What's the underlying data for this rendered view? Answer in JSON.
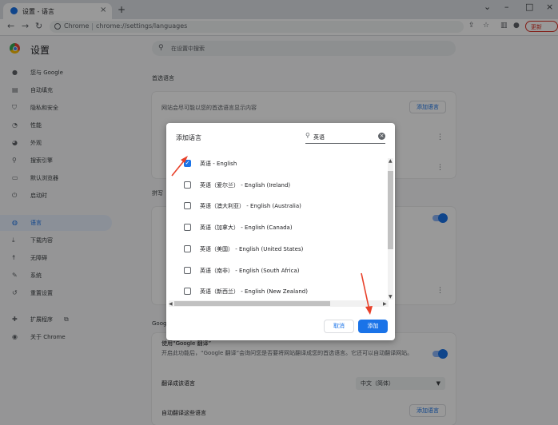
{
  "browser": {
    "tab_title": "设置 - 语言",
    "new_tab": "+",
    "omnibox_chip": "Chrome",
    "url": "chrome://settings/languages",
    "update_label": "更新"
  },
  "settings": {
    "title": "设置",
    "search_placeholder": "在设置中搜索",
    "sidebar": [
      {
        "label": "您与 Google",
        "icon": "person-icon"
      },
      {
        "label": "自动填充",
        "icon": "autofill-icon"
      },
      {
        "label": "隐私和安全",
        "icon": "shield-icon"
      },
      {
        "label": "性能",
        "icon": "speedometer-icon"
      },
      {
        "label": "外观",
        "icon": "palette-icon"
      },
      {
        "label": "搜索引擎",
        "icon": "search-icon"
      },
      {
        "label": "默认浏览器",
        "icon": "browser-icon"
      },
      {
        "label": "启动时",
        "icon": "power-icon"
      },
      {
        "label": "语言",
        "icon": "globe-icon"
      },
      {
        "label": "下载内容",
        "icon": "download-icon"
      },
      {
        "label": "无障碍",
        "icon": "accessibility-icon"
      },
      {
        "label": "系统",
        "icon": "wrench-icon"
      },
      {
        "label": "重置设置",
        "icon": "history-icon"
      },
      {
        "label": "扩展程序",
        "icon": "puzzle-icon"
      },
      {
        "label": "关于 Chrome",
        "icon": "chrome-icon"
      }
    ],
    "preferred_section_title": "首选语言",
    "preferred_desc": "网站会尽可能以您的首选语言显示内容",
    "add_language_label": "添加语言",
    "spellcheck_partial": "拼写",
    "google_partial": "Google",
    "translate_title": "使用“Google 翻译”",
    "translate_desc": "开启此功能后，“Google 翻译”会询问您是否要将网站翻译成您的首选语言。它还可以自动翻译网站。",
    "translate_target_label": "翻译成该语言",
    "translate_target_value": "中文（简体）",
    "auto_translate_label": "自动翻译这些语言",
    "add_language_label_2": "添加语言"
  },
  "dialog": {
    "title": "添加语言",
    "search_value": "英语",
    "languages": [
      {
        "label": "英语 - English",
        "checked": true
      },
      {
        "label": "英语（爱尔兰） - English (Ireland)",
        "checked": false
      },
      {
        "label": "英语（澳大利亚） - English (Australia)",
        "checked": false
      },
      {
        "label": "英语（加拿大） - English (Canada)",
        "checked": false
      },
      {
        "label": "英语（美国） - English (United States)",
        "checked": false
      },
      {
        "label": "英语（南非） - English (South Africa)",
        "checked": false
      },
      {
        "label": "英语（新西兰） - English (New Zealand)",
        "checked": false
      }
    ],
    "cancel_label": "取消",
    "add_label": "添加"
  },
  "colors": {
    "accent": "#1a73e8",
    "annotation": "#e8412a"
  }
}
